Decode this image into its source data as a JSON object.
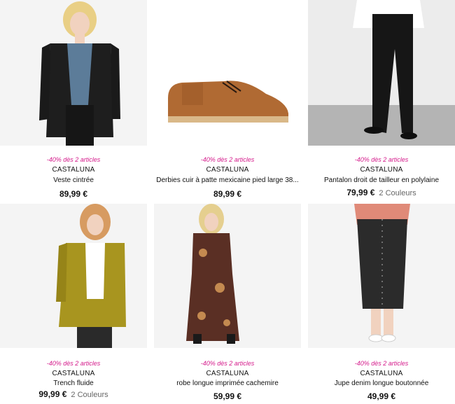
{
  "products": [
    {
      "promo": "-40% dès 2 articles",
      "brand": "CASTALUNA",
      "name": "Veste cintrée",
      "price": "89,99 €",
      "colors": ""
    },
    {
      "promo": "-40% dès 2 articles",
      "brand": "CASTALUNA",
      "name": "Derbies cuir à patte mexicaine pied large 38...",
      "price": "89,99 €",
      "colors": ""
    },
    {
      "promo": "-40% dès 2 articles",
      "brand": "CASTALUNA",
      "name": "Pantalon droit de tailleur en polylaine",
      "price": "79,99 €",
      "colors": "2 Couleurs"
    },
    {
      "promo": "-40% dès 2 articles",
      "brand": "CASTALUNA",
      "name": "Trench fluide",
      "price": "99,99 €",
      "colors": "2 Couleurs"
    },
    {
      "promo": "-40% dès 2 articles",
      "brand": "CASTALUNA",
      "name": "robe longue imprimée cachemire",
      "price": "59,99 €",
      "colors": ""
    },
    {
      "promo": "-40% dès 2 articles",
      "brand": "CASTALUNA",
      "name": "Jupe denim longue boutonnée",
      "price": "49,99 €",
      "colors": ""
    }
  ],
  "theme": {
    "promo_color": "#d4198a",
    "text_color": "#111111",
    "muted_color": "#666666"
  }
}
